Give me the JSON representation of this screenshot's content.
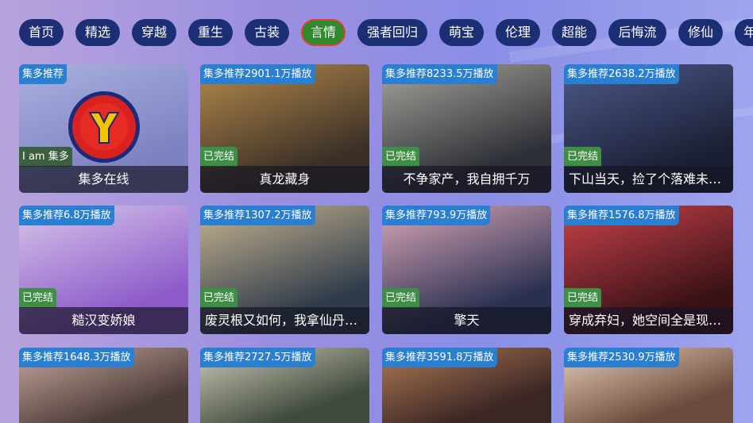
{
  "tabs": [
    {
      "label": "首页",
      "active": false
    },
    {
      "label": "精选",
      "active": false
    },
    {
      "label": "穿越",
      "active": false
    },
    {
      "label": "重生",
      "active": false
    },
    {
      "label": "古装",
      "active": false
    },
    {
      "label": "言情",
      "active": true
    },
    {
      "label": "强者回归",
      "active": false
    },
    {
      "label": "萌宝",
      "active": false
    },
    {
      "label": "伦理",
      "active": false
    },
    {
      "label": "超能",
      "active": false
    },
    {
      "label": "后悔流",
      "active": false
    },
    {
      "label": "修仙",
      "active": false
    },
    {
      "label": "年",
      "active": false
    }
  ],
  "cards": [
    {
      "badge": "集多推荐",
      "status": "I am 集多",
      "title": "集多在线",
      "thumb_colors": [
        "#7c82bf",
        "#a9b0e0"
      ]
    },
    {
      "badge": "集多推荐2901.1万播放",
      "status": "已完结",
      "title": "真龙藏身",
      "thumb_colors": [
        "#3a3026",
        "#b58a4c"
      ]
    },
    {
      "badge": "集多推荐8233.5万播放",
      "status": "已完结",
      "title": "不争家产，我自拥千万",
      "thumb_colors": [
        "#2c2f35",
        "#a7a49c"
      ]
    },
    {
      "badge": "集多推荐2638.2万播放",
      "status": "已完结",
      "title": "下山当天，捡了个落难未婚...",
      "thumb_colors": [
        "#1b1f34",
        "#4d5a8a"
      ]
    },
    {
      "badge": "集多推荐6.8万播放",
      "status": "已完结",
      "title": "糙汉变娇娘",
      "thumb_colors": [
        "#8d5bc9",
        "#d6c6ea"
      ]
    },
    {
      "badge": "集多推荐1307.2万播放",
      "status": "已完结",
      "title": "废灵根又如何，我拿仙丹当...",
      "thumb_colors": [
        "#2f3b4a",
        "#c7b590"
      ]
    },
    {
      "badge": "集多推荐793.9万播放",
      "status": "已完结",
      "title": "擎天",
      "thumb_colors": [
        "#2a3050",
        "#d9a7b7"
      ]
    },
    {
      "badge": "集多推荐1576.8万播放",
      "status": "已完结",
      "title": "穿成弃妇，她空间全是现代...",
      "thumb_colors": [
        "#3a1216",
        "#c8424a"
      ]
    },
    {
      "badge": "集多推荐1648.3万播放",
      "status": "",
      "title": "",
      "thumb_colors": [
        "#4b3c3a",
        "#c9a79b"
      ]
    },
    {
      "badge": "集多推荐2727.5万播放",
      "status": "",
      "title": "",
      "thumb_colors": [
        "#3e4a3c",
        "#cfcab9"
      ]
    },
    {
      "badge": "集多推荐3591.8万播放",
      "status": "",
      "title": "",
      "thumb_colors": [
        "#3a2624",
        "#b07a54"
      ]
    },
    {
      "badge": "集多推荐2530.9万播放",
      "status": "",
      "title": "",
      "thumb_colors": [
        "#6a4a3a",
        "#e7cfba"
      ]
    }
  ],
  "logo": {
    "letter": "Y"
  }
}
